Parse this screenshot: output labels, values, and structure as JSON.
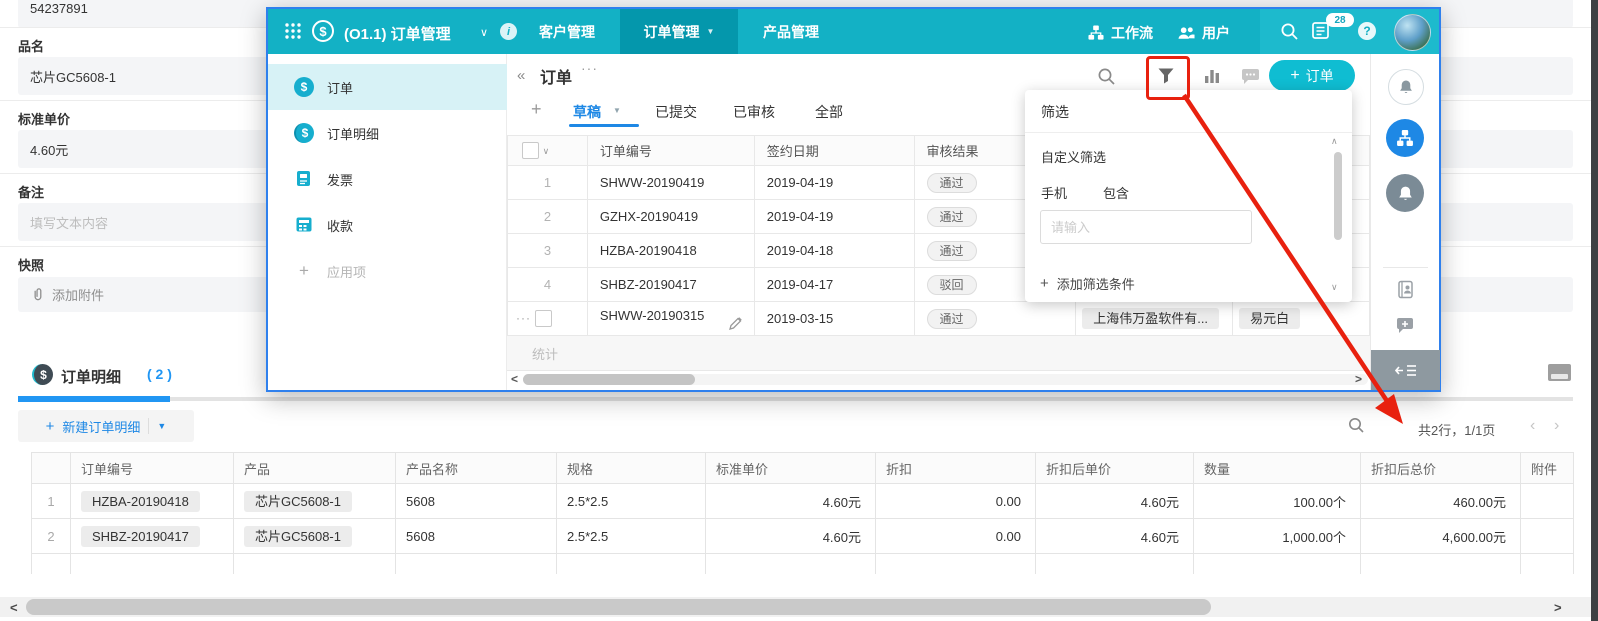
{
  "glyphs": {
    "collapse": "«",
    "more": "···",
    "chevron_down": "∨",
    "caret_down": "▼",
    "plus": "+",
    "dollar": "$",
    "prev": "‹",
    "next": "›",
    "left": "<",
    "right": ">",
    "up": "∧",
    "question": "?",
    "info": "i",
    "ellipsis": "···"
  },
  "page": {
    "form": {
      "top_value": "54237891",
      "name_label": "品名",
      "name_value": "芯片GC5608-1",
      "price_label": "标准单价",
      "price_value": "4.60元",
      "note_label": "备注",
      "note_placeholder": "填写文本内容",
      "snapshot_label": "快照",
      "attach_label": "添加附件"
    },
    "detail": {
      "title": "订单明细",
      "count": "( 2 )",
      "new_button": "新建订单明细",
      "pagination": "共2行，1/1页",
      "columns": [
        "订单编号",
        "产品",
        "产品名称",
        "规格",
        "标准单价",
        "折扣",
        "折扣后单价",
        "数量",
        "折扣后总价",
        "附件"
      ],
      "rows": [
        {
          "num": "1",
          "order_no": "HZBA-20190418",
          "product": "芯片GC5608-1",
          "name": "5608",
          "spec": "2.5*2.5",
          "price": "4.60元",
          "discount": "0.00",
          "disc_price": "4.60元",
          "qty": "100.00个",
          "total": "460.00元"
        },
        {
          "num": "2",
          "order_no": "SHBZ-20190417",
          "product": "芯片GC5608-1",
          "name": "5608",
          "spec": "2.5*2.5",
          "price": "4.60元",
          "discount": "0.00",
          "disc_price": "4.60元",
          "qty": "1,000.00个",
          "total": "4,600.00元"
        }
      ]
    }
  },
  "popup": {
    "header": {
      "app_title": "(O1.1) 订单管理",
      "nav": [
        "客户管理",
        "订单管理",
        "产品管理"
      ],
      "workflow_label": "工作流",
      "users_label": "用户",
      "badge": "28"
    },
    "sidebar": {
      "items": [
        "订单",
        "订单明细",
        "发票",
        "收款"
      ],
      "add_label": "应用项"
    },
    "main": {
      "title": "订单",
      "tabs": [
        "草稿",
        "已提交",
        "已审核",
        "全部"
      ],
      "new_order_label": "订单",
      "columns": [
        "订单编号",
        "签约日期",
        "审核结果"
      ],
      "rows": [
        {
          "num": "1",
          "no": "SHWW-20190419",
          "date": "2019-04-19",
          "result": "通过"
        },
        {
          "num": "2",
          "no": "GZHX-20190419",
          "date": "2019-04-19",
          "result": "通过"
        },
        {
          "num": "3",
          "no": "HZBA-20190418",
          "date": "2019-04-18",
          "result": "通过"
        },
        {
          "num": "4",
          "no": "SHBZ-20190417",
          "date": "2019-04-17",
          "result": "驳回"
        },
        {
          "num": "",
          "no": "SHWW-20190315",
          "date": "2019-03-15",
          "result": "通过",
          "customer": "上海伟万盈软件有...",
          "owner": "易元白"
        }
      ],
      "stats_label": "统计"
    },
    "filter": {
      "title": "筛选",
      "section": "自定义筛选",
      "field": "手机",
      "operator": "包含",
      "placeholder": "请输入",
      "add_label": "添加筛选条件"
    }
  },
  "colors": {
    "header_teal": "#13b1c5",
    "header_active": "#0497ac",
    "accent_blue": "#1e88e5",
    "button_teal": "#0fbdd2",
    "annotation_red": "#e8210f"
  }
}
